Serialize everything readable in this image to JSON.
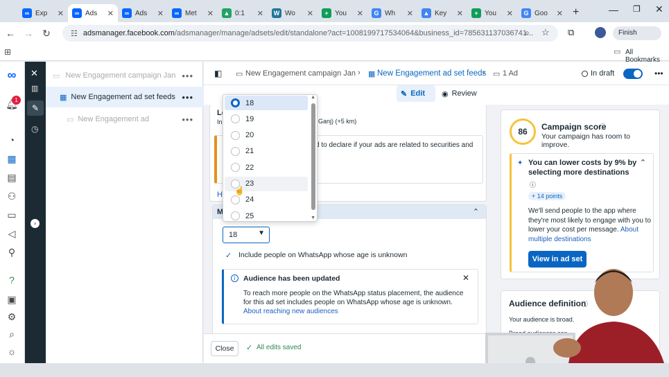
{
  "browser": {
    "tabs": [
      {
        "label": "Exp",
        "color": "#0866ff",
        "glyph": "∞"
      },
      {
        "label": "Ads",
        "color": "#0866ff",
        "glyph": "∞"
      },
      {
        "label": "Ads",
        "color": "#0866ff",
        "glyph": "∞"
      },
      {
        "label": "Met",
        "color": "#0866ff",
        "glyph": "∞"
      },
      {
        "label": "0:1",
        "color": "#1fa463",
        "glyph": "▲"
      },
      {
        "label": "Wo",
        "color": "#21759b",
        "glyph": "W"
      },
      {
        "label": "You",
        "color": "#0f9d58",
        "glyph": "+"
      },
      {
        "label": "Wh",
        "color": "#4285f4",
        "glyph": "G"
      },
      {
        "label": "Key",
        "color": "#4285f4",
        "glyph": "▲"
      },
      {
        "label": "You",
        "color": "#0f9d58",
        "glyph": "+"
      },
      {
        "label": "Goo",
        "color": "#4285f4",
        "glyph": "G"
      }
    ],
    "url_host": "adsmanager.facebook.com",
    "url_path": "/adsmanager/manage/adsets/edit/standalone?act=1008199717534064&business_id=785631137036741...",
    "profile_label": "Finish",
    "bookmarks_label": "All Bookmarks"
  },
  "nav": {
    "campaign": "New Engagement campaign Jan",
    "adset": "New Engagement ad set feeds",
    "ad": "New Engagement ad"
  },
  "topbar": {
    "crumb_campaign": "New Engagement campaign Jan",
    "crumb_adset": "New Engagement ad set feeds",
    "crumb_ad": "1 Ad",
    "status": "In draft",
    "edit": "Edit",
    "review": "Review"
  },
  "editor": {
    "loc_label": "Lo",
    "loc_sub": "In",
    "loc_text": "Ganj) (+5 km)",
    "notice_text": "d to declare if your ads are related to securities and",
    "h_link": "H",
    "section_letter": "M",
    "age_value": "18",
    "include_unknown": "Include people on WhatsApp whose age is unknown",
    "updated_title": "Audience has been updated",
    "updated_body": "To reach more people on the WhatsApp status placement, the audience for this ad set includes people on WhatsApp whose age is unknown.",
    "updated_link": "About reaching new audiences"
  },
  "age_options": [
    "18",
    "19",
    "20",
    "21",
    "22",
    "23",
    "24",
    "25"
  ],
  "footer": {
    "close": "Close",
    "saved": "All edits saved"
  },
  "right": {
    "score": "86",
    "score_title": "Campaign score",
    "score_sub": "Your campaign has room to improve.",
    "tip_title": "You can lower costs by 9% by selecting more destinations",
    "points": "+ 14 points",
    "tip_body": "We'll send people to the app where they're most likely to engage with you to lower your cost per message.",
    "tip_link": "About multiple destinations",
    "view_btn": "View in ad set",
    "aud_title": "Audience definition",
    "aud_sub": "Your audience is broad.",
    "aud_sub2": "Broad audiences can"
  },
  "badges": {
    "notifications": "1"
  },
  "colors": {
    "accent": "#0a66c2",
    "dark_rail": "#1c2b33",
    "success": "#2d8a4e",
    "warning": "#e2911b"
  }
}
